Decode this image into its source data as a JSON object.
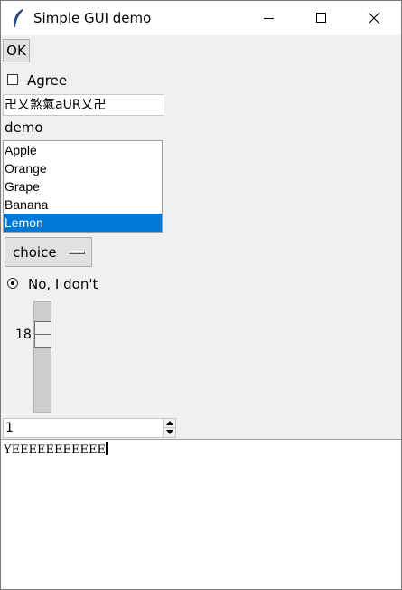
{
  "window": {
    "title": "Simple GUI demo",
    "icons": {
      "app": "feather-icon",
      "minimize": "minimize-icon",
      "maximize": "maximize-icon",
      "close": "close-icon"
    }
  },
  "ok_button": {
    "label": "OK"
  },
  "agree_checkbox": {
    "label": "Agree",
    "checked": false
  },
  "entry": {
    "value": "卍乂煞氣aUR乂卍"
  },
  "demo_label": {
    "text": "demo"
  },
  "listbox": {
    "items": [
      "Apple",
      "Orange",
      "Grape",
      "Banana",
      "Lemon"
    ],
    "selected": "Lemon",
    "selected_color": "#0078d7"
  },
  "option_menu": {
    "label": "choice"
  },
  "radio": {
    "label": "No, I don't",
    "selected": true
  },
  "scale": {
    "value": "18"
  },
  "spinbox": {
    "value": "1"
  },
  "text_area": {
    "content": "YEEEEEEEEEEE"
  }
}
